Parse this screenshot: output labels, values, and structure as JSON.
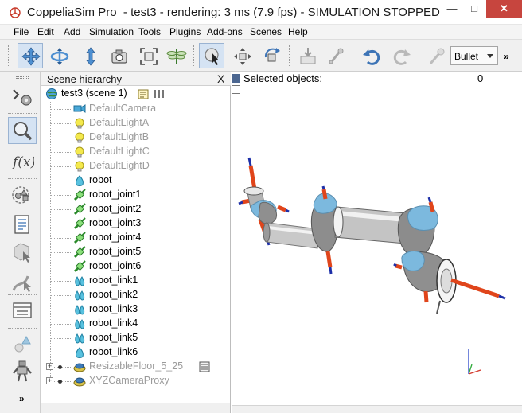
{
  "window": {
    "app_name": "CoppeliaSim Pro",
    "title_rest": "- test3 - rendering: 3 ms (7.9 fps) - SIMULATION STOPPED"
  },
  "menu": [
    "File",
    "Edit",
    "Add",
    "Simulation",
    "Tools",
    "Plugins",
    "Add-ons",
    "Scenes",
    "Help"
  ],
  "toolbar": {
    "physics_engine": "Bullet",
    "more": "»"
  },
  "left_toolbar": {
    "more": "»"
  },
  "hierarchy": {
    "title": "Scene hierarchy",
    "close": "X",
    "scene_label": "test3 (scene 1)",
    "items": [
      {
        "label": "DefaultCamera",
        "icon": "camera-icon"
      },
      {
        "label": "DefaultLightA",
        "icon": "light-icon"
      },
      {
        "label": "DefaultLightB",
        "icon": "light-icon"
      },
      {
        "label": "DefaultLightC",
        "icon": "light-icon"
      },
      {
        "label": "DefaultLightD",
        "icon": "light-icon"
      },
      {
        "label": "robot",
        "icon": "shape-icon"
      },
      {
        "label": "robot_joint1",
        "icon": "joint-icon"
      },
      {
        "label": "robot_joint2",
        "icon": "joint-icon"
      },
      {
        "label": "robot_joint3",
        "icon": "joint-icon"
      },
      {
        "label": "robot_joint4",
        "icon": "joint-icon"
      },
      {
        "label": "robot_joint5",
        "icon": "joint-icon"
      },
      {
        "label": "robot_joint6",
        "icon": "joint-icon"
      },
      {
        "label": "robot_link1",
        "icon": "compound-shape-icon"
      },
      {
        "label": "robot_link2",
        "icon": "compound-shape-icon"
      },
      {
        "label": "robot_link3",
        "icon": "compound-shape-icon"
      },
      {
        "label": "robot_link4",
        "icon": "compound-shape-icon"
      },
      {
        "label": "robot_link5",
        "icon": "compound-shape-icon"
      },
      {
        "label": "robot_link6",
        "icon": "shape-icon"
      },
      {
        "label": "ResizableFloor_5_25",
        "icon": "model-icon"
      },
      {
        "label": "XYZCameraProxy",
        "icon": "model-icon"
      }
    ]
  },
  "viewport": {
    "selected_label": "Selected objects:",
    "selected_count": "0"
  },
  "colors": {
    "selection_blue": "#d5e3f3",
    "robot_gray": "#a8a8a8",
    "joint_blue": "#6fb2d8",
    "axis_red": "#e0451b",
    "axis_blue": "#1d2fa8"
  }
}
